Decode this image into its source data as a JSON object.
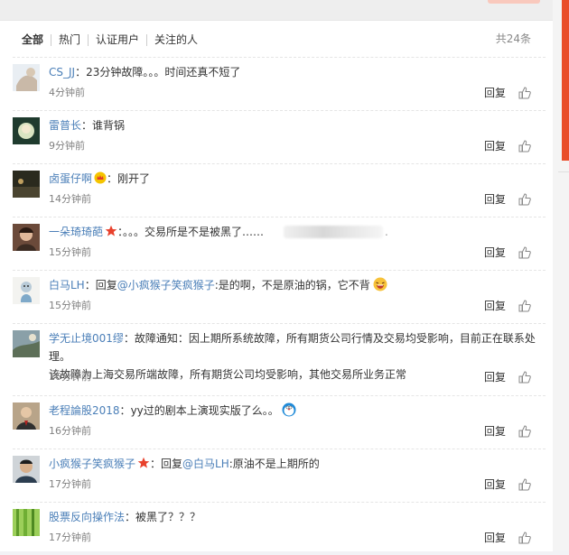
{
  "tabs": {
    "all": "全部",
    "hot": "热门",
    "verified": "认证用户",
    "following": "关注的人",
    "total": "共24条"
  },
  "actions": {
    "reply": "回复"
  },
  "comments": [
    {
      "user": "CS_JJ",
      "sep": "：",
      "text": "23分钟故障。。。时间还真不短了",
      "time": "4分钟前"
    },
    {
      "user": "雷普长",
      "sep": "：",
      "text": "谁背锅",
      "time": "9分钟前"
    },
    {
      "user": "卤蛋仔啊",
      "sep": "：",
      "text": "刚开了",
      "time": "14分钟前"
    },
    {
      "user": "一朵琦琦葩",
      "sep": "：",
      "text": "。。。交易所是不是被黑了……",
      "tail": ".",
      "time": "15分钟前"
    },
    {
      "user": "白马LH",
      "sep": "：",
      "reply_prefix": "回复",
      "reply_target": "@小疯猴子笑疯猴子",
      "text": ":是的啊，不是原油的锅，它不背",
      "time": "15分钟前"
    },
    {
      "user": "学无止境001缪",
      "sep": "：",
      "text": "故障通知：因上期所系统故障，所有期货公司行情及交易均受影响，目前正在联系处理。",
      "text2": "该故障为上海交易所端故障，所有期货公司均受影响，其他交易所业务正常",
      "time": "16分钟前"
    },
    {
      "user": "老程論股2018",
      "sep": "：",
      "text": "yy过的剧本上演现实版了么。。",
      "time": "16分钟前"
    },
    {
      "user": "小疯猴子笑疯猴子",
      "sep": "：",
      "reply_prefix": "回复",
      "reply_target": "@白马LH",
      "text": ":原油不是上期所的",
      "time": "17分钟前"
    },
    {
      "user": "股票反向操作法",
      "sep": "：",
      "text": "被黑了？？？",
      "time": "17分钟前"
    }
  ],
  "colors": {
    "username": "#4b7fb8",
    "link": "#eb7350",
    "time": "#808080"
  }
}
